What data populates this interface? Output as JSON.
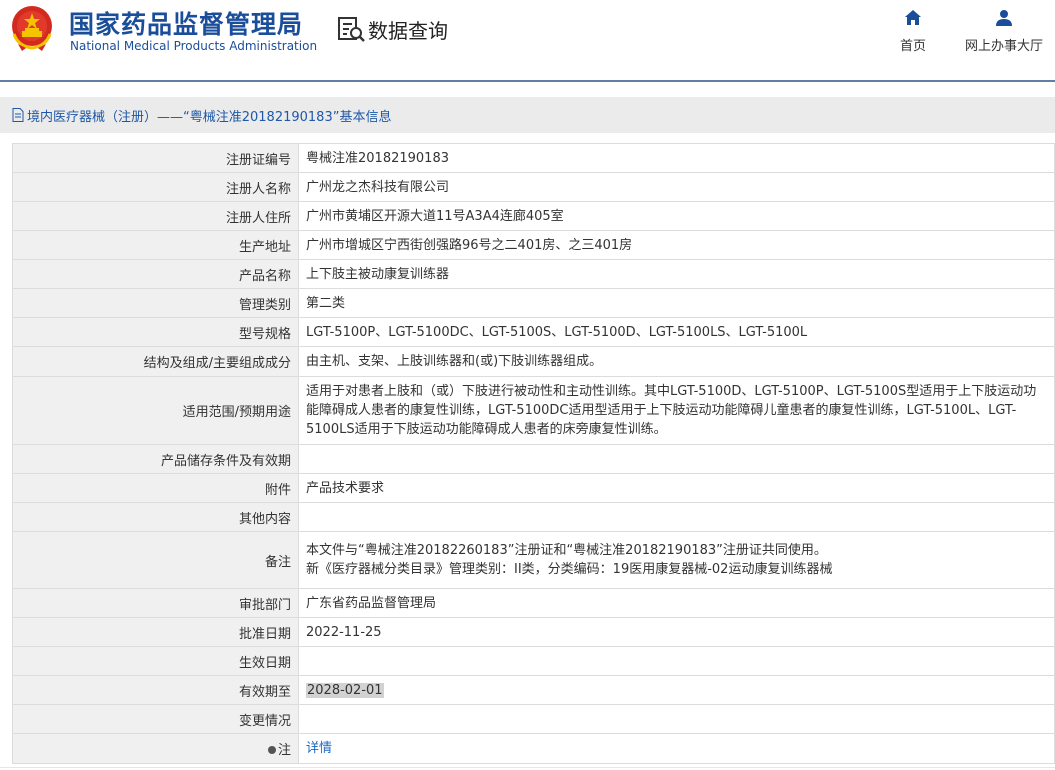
{
  "header": {
    "site_name_cn": "国家药品监督管理局",
    "site_name_en": "National Medical Products Administration",
    "query_label": "数据查询",
    "nav": [
      {
        "label": "首页",
        "icon": "home-icon"
      },
      {
        "label": "网上办事大厅",
        "icon": "user-icon"
      }
    ]
  },
  "titlebar": {
    "icon": "document-icon",
    "text": "境内医疗器械（注册）——“粤械注准20182190183”基本信息"
  },
  "record": {
    "rows": [
      {
        "label": "注册证编号",
        "value": "粤械注准20182190183"
      },
      {
        "label": "注册人名称",
        "value": "广州龙之杰科技有限公司"
      },
      {
        "label": "注册人住所",
        "value": "广州市黄埔区开源大道11号A3A4连廊405室"
      },
      {
        "label": "生产地址",
        "value": "广州市增城区宁西街创强路96号之二401房、之三401房"
      },
      {
        "label": "产品名称",
        "value": "上下肢主被动康复训练器"
      },
      {
        "label": "管理类别",
        "value": "第二类"
      },
      {
        "label": "型号规格",
        "value": "LGT-5100P、LGT-5100DC、LGT-5100S、LGT-5100D、LGT-5100LS、LGT-5100L"
      },
      {
        "label": "结构及组成/主要组成成分",
        "value": "由主机、支架、上肢训练器和(或)下肢训练器组成。"
      },
      {
        "label": "适用范围/预期用途",
        "value": "适用于对患者上肢和（或）下肢进行被动性和主动性训练。其中LGT-5100D、LGT-5100P、LGT-5100S型适用于上下肢运动功能障碍成人患者的康复性训练，LGT-5100DC适用型适用于上下肢运动功能障碍儿童患者的康复性训练，LGT-5100L、LGT-5100LS适用于下肢运动功能障碍成人患者的床旁康复性训练。"
      },
      {
        "label": "产品储存条件及有效期",
        "value": ""
      },
      {
        "label": "附件",
        "value": "产品技术要求"
      },
      {
        "label": "其他内容",
        "value": ""
      },
      {
        "label": "备注",
        "value_line1": "本文件与“粤械注准20182260183”注册证和“粤械注准20182190183”注册证共同使用。",
        "value_line2": "新《医疗器械分类目录》管理类别：II类，分类编码：19医用康复器械-02运动康复训练器械"
      },
      {
        "label": "审批部门",
        "value": "广东省药品监督管理局"
      },
      {
        "label": "批准日期",
        "value": "2022-11-25"
      },
      {
        "label": "生效日期",
        "value": ""
      },
      {
        "label": "有效期至",
        "value": "2028-02-01"
      },
      {
        "label": "变更情况",
        "value": ""
      },
      {
        "label": "注",
        "value": "详情",
        "icon": "lightbulb-icon"
      }
    ]
  },
  "colors": {
    "brand_blue": "#1b4e9a",
    "link_blue": "#1e68c0",
    "label_bg": "#f0f0f0",
    "titlebar_bg": "#ebebeb"
  }
}
